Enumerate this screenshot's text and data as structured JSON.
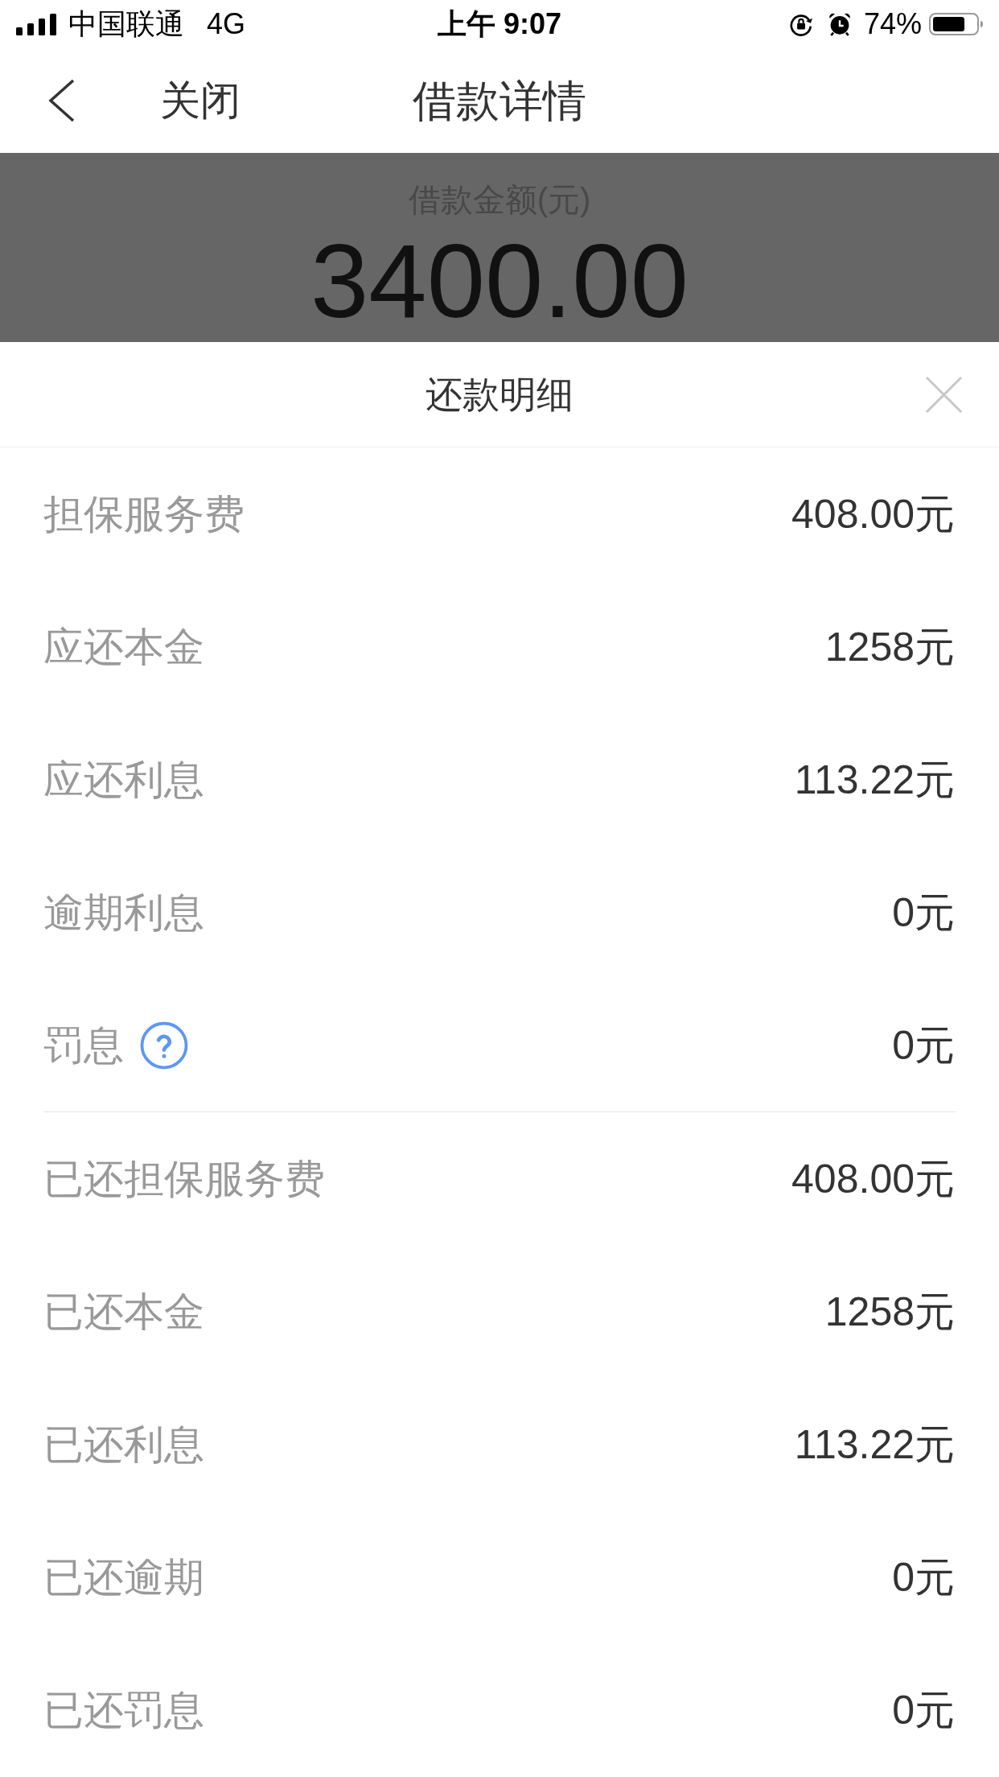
{
  "status_bar": {
    "carrier": "中国联通",
    "network": "4G",
    "time": "上午 9:07",
    "battery": "74%"
  },
  "nav_bar": {
    "close_label": "关闭",
    "title": "借款详情"
  },
  "loan_summary": {
    "label": "借款金额(元)",
    "amount": "3400.00"
  },
  "sheet": {
    "title": "还款明细",
    "sections": [
      {
        "rows": [
          {
            "label": "担保服务费",
            "value": "408.00元",
            "help": false
          },
          {
            "label": "应还本金",
            "value": "1258元",
            "help": false
          },
          {
            "label": "应还利息",
            "value": "113.22元",
            "help": false
          },
          {
            "label": "逾期利息",
            "value": "0元",
            "help": false
          },
          {
            "label": "罚息",
            "value": "0元",
            "help": true
          }
        ]
      },
      {
        "rows": [
          {
            "label": "已还担保服务费",
            "value": "408.00元",
            "help": false
          },
          {
            "label": "已还本金",
            "value": "1258元",
            "help": false
          },
          {
            "label": "已还利息",
            "value": "113.22元",
            "help": false
          },
          {
            "label": "已还逾期",
            "value": "0元",
            "help": false
          },
          {
            "label": "已还罚息",
            "value": "0元",
            "help": false
          }
        ]
      }
    ]
  }
}
